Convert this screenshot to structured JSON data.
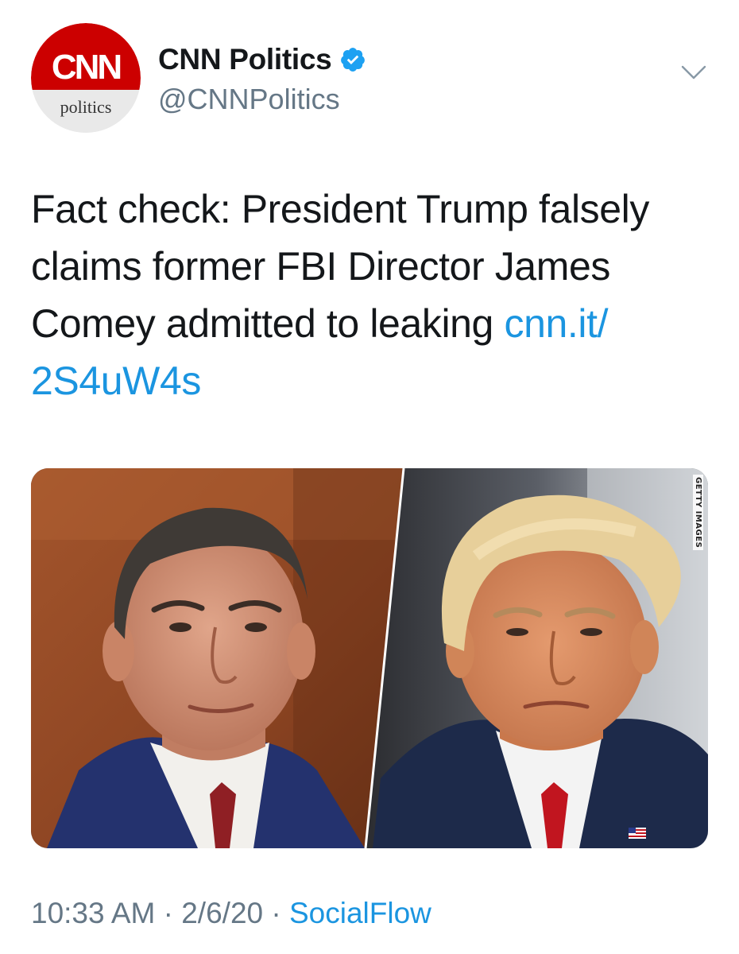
{
  "tweet": {
    "avatar": {
      "logo_text": "CNN",
      "sub_text": "politics",
      "brand_red": "#cc0000"
    },
    "author": {
      "display_name": "CNN Politics",
      "handle": "@CNNPolitics",
      "verified": true,
      "verified_color": "#1da1f2"
    },
    "menu_icon": "chevron-down-icon",
    "text": {
      "main": "Fact check: President Trump falsely claims former FBI Director James Comey admitted to leaking ",
      "link": "cnn.it/​2S4uW4s",
      "link_color": "#1b95e0"
    },
    "media": {
      "watermark": "GETTY IMAGES"
    },
    "meta": {
      "time": "10:33 AM",
      "separator": " · ",
      "date": "2/6/20",
      "source": "SocialFlow"
    }
  }
}
